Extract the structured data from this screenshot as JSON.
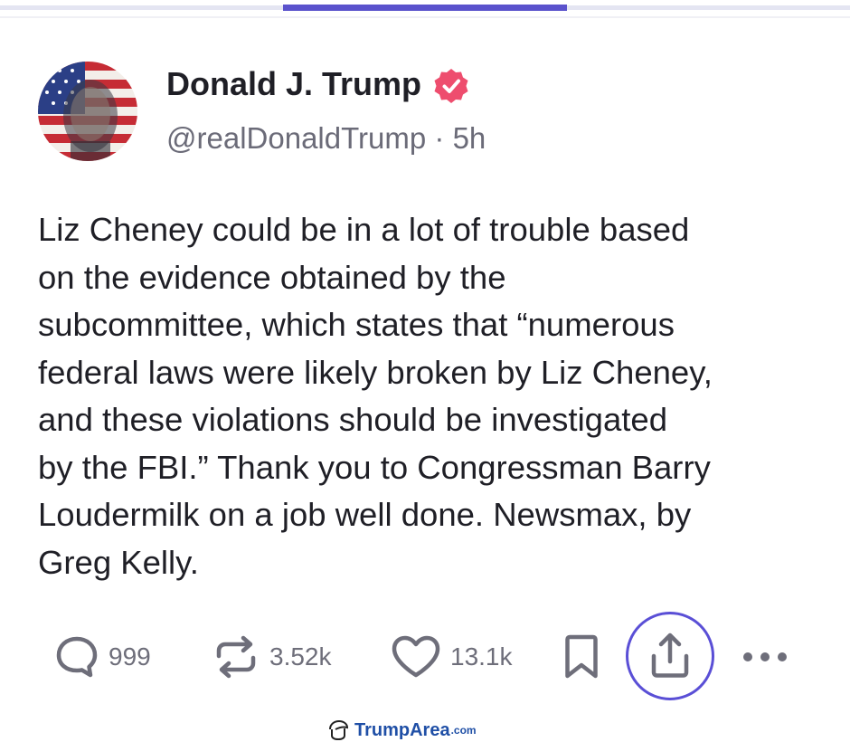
{
  "post": {
    "author_name": "Donald J. Trump",
    "handle": "@realDonaldTrump",
    "separator": "·",
    "time_ago": "5h",
    "text": "Liz Cheney could be in a lot of trouble based\non the evidence obtained by the\nsubcommittee, which states that “numerous\nfederal laws were likely broken by Liz Cheney,\nand these violations should be investigated\nby the FBI.” Thank you to Congressman Barry\nLoudermilk on a job well done. Newsmax, by\nGreg Kelly."
  },
  "actions": {
    "replies": {
      "icon": "comment-icon",
      "count": "999"
    },
    "retruths": {
      "icon": "repost-icon",
      "count": "3.52k"
    },
    "likes": {
      "icon": "heart-icon",
      "count": "13.1k"
    },
    "bookmark": {
      "icon": "bookmark-icon"
    },
    "share": {
      "icon": "share-icon"
    },
    "more": {
      "icon": "more-dots-icon"
    }
  },
  "watermark": {
    "name": "TrumpArea",
    "suffix": ".com"
  },
  "colors": {
    "accent": "#5a4fd6",
    "verified_badge": "#ee4d6e",
    "muted_text": "#6b6b78",
    "watermark": "#1f4fa6"
  }
}
